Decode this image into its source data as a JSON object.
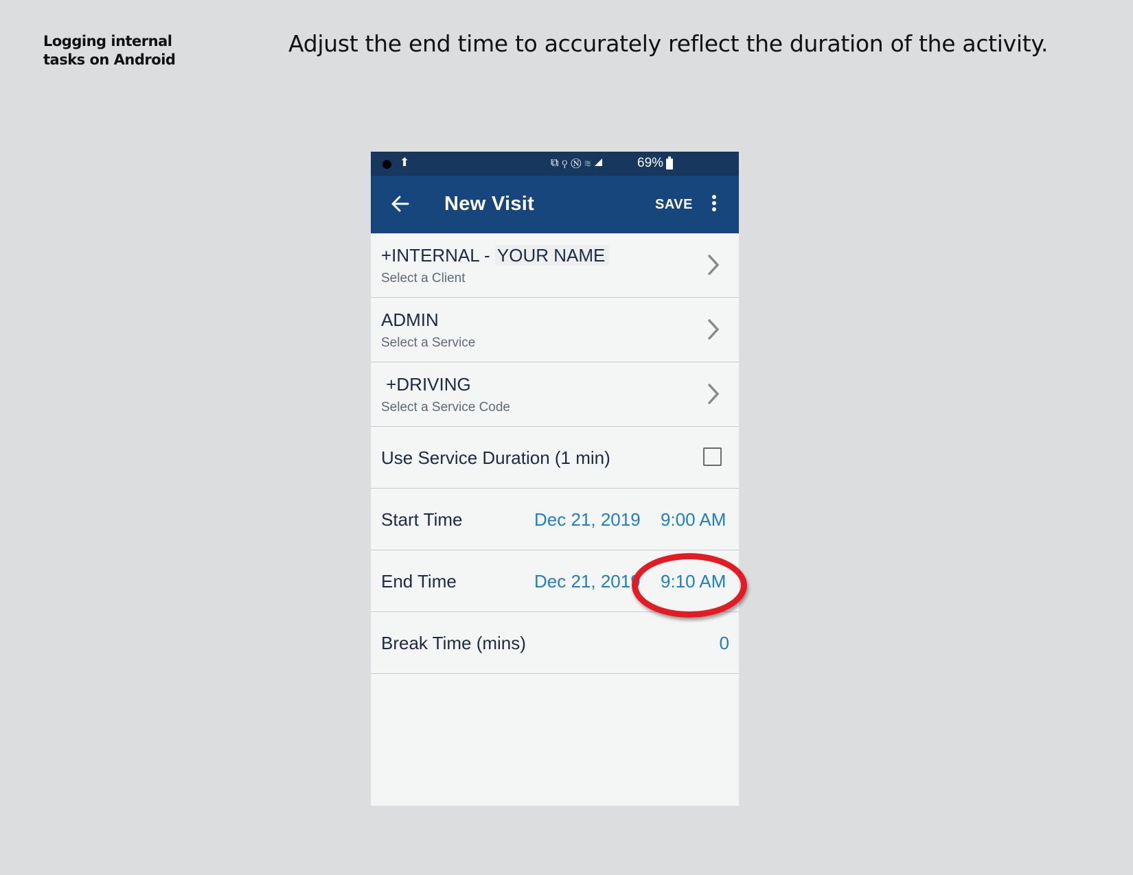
{
  "caption": {
    "line1": "Logging internal",
    "line2": "tasks on Android"
  },
  "headline": "Adjust the end time to accurately reflect the duration of the activity.",
  "status_bar": {
    "battery": "69%",
    "upload_glyph": "⬆",
    "icons_glyphs": "⧉⚲Ⓝ≋◢"
  },
  "app_bar": {
    "title": "New Visit",
    "save_label": "SAVE"
  },
  "client": {
    "prefix": "+INTERNAL - ",
    "name": "YOUR NAME",
    "hint": "Select a Client"
  },
  "service": {
    "value": "ADMIN",
    "hint": "Select a Service"
  },
  "service_code": {
    "value": " +DRIVING",
    "hint": "Select a Service Code"
  },
  "use_duration": {
    "label": "Use Service Duration (1 min)",
    "checked": false
  },
  "start_time": {
    "label": "Start Time",
    "date": "Dec 21, 2019",
    "time": "9:00 AM"
  },
  "end_time": {
    "label": "End Time",
    "date": "Dec 21, 2019",
    "time": "9:10 AM"
  },
  "break_time": {
    "label": "Break Time (mins)",
    "value": "0"
  },
  "colors": {
    "app_bar": "#17467c",
    "status_bar": "#17375f",
    "link": "#1f7fc0",
    "highlight": "#e31b23"
  }
}
